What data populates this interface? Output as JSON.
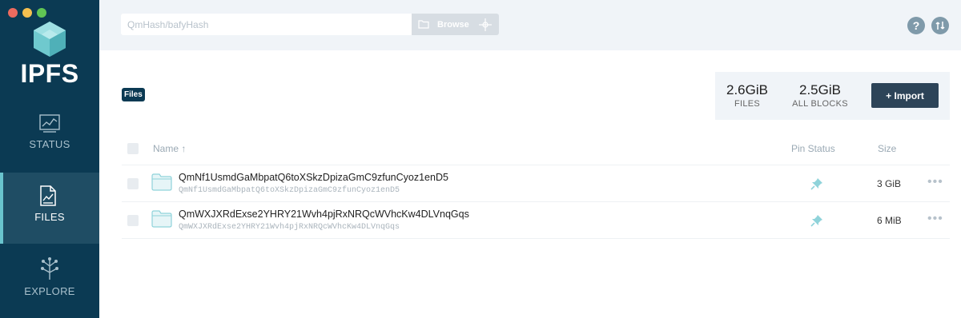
{
  "window": {
    "traffic_colors": [
      "#ed6b5f",
      "#f5bf4f",
      "#61c554"
    ]
  },
  "sidebar": {
    "logo_text": "IPFS",
    "items": [
      {
        "label": "STATUS",
        "icon": "status-chart-icon",
        "active": false
      },
      {
        "label": "FILES",
        "icon": "files-document-icon",
        "active": true
      },
      {
        "label": "EXPLORE",
        "icon": "explore-tree-icon",
        "active": false
      }
    ]
  },
  "header": {
    "search_placeholder": "QmHash/bafyHash",
    "browse_label": "Browse",
    "help_icon": "help-icon",
    "update_icon": "ipfs-update-icon"
  },
  "main": {
    "breadcrumb": "Files",
    "stats": {
      "files_value": "2.6GiB",
      "files_caption": "FILES",
      "blocks_value": "2.5GiB",
      "blocks_caption": "ALL BLOCKS"
    },
    "import_label": "+ Import",
    "table": {
      "headers": {
        "name": "Name ↑",
        "pin_status": "Pin Status",
        "size": "Size"
      },
      "rows": [
        {
          "name": "QmNf1UsmdGaMbpatQ6toXSkzDpizaGmC9zfunCyoz1enD5",
          "hash": "QmNf1UsmdGaMbpatQ6toXSkzDpizaGmC9zfunCyoz1enD5",
          "size": "3 GiB"
        },
        {
          "name": "QmWXJXRdExse2YHRY21Wvh4pjRxNRQcWVhcKw4DLVnqGqs",
          "hash": "QmWXJXRdExse2YHRY21Wvh4pjRxNRQcWVhcKw4DLVnqGqs",
          "size": "6 MiB"
        }
      ],
      "more_label": "•••"
    }
  },
  "colors": {
    "sidebar_bg": "#0b3a53",
    "active_bg": "#1f4d64",
    "accent": "#69c4cd",
    "import_bg": "#2d4458"
  }
}
